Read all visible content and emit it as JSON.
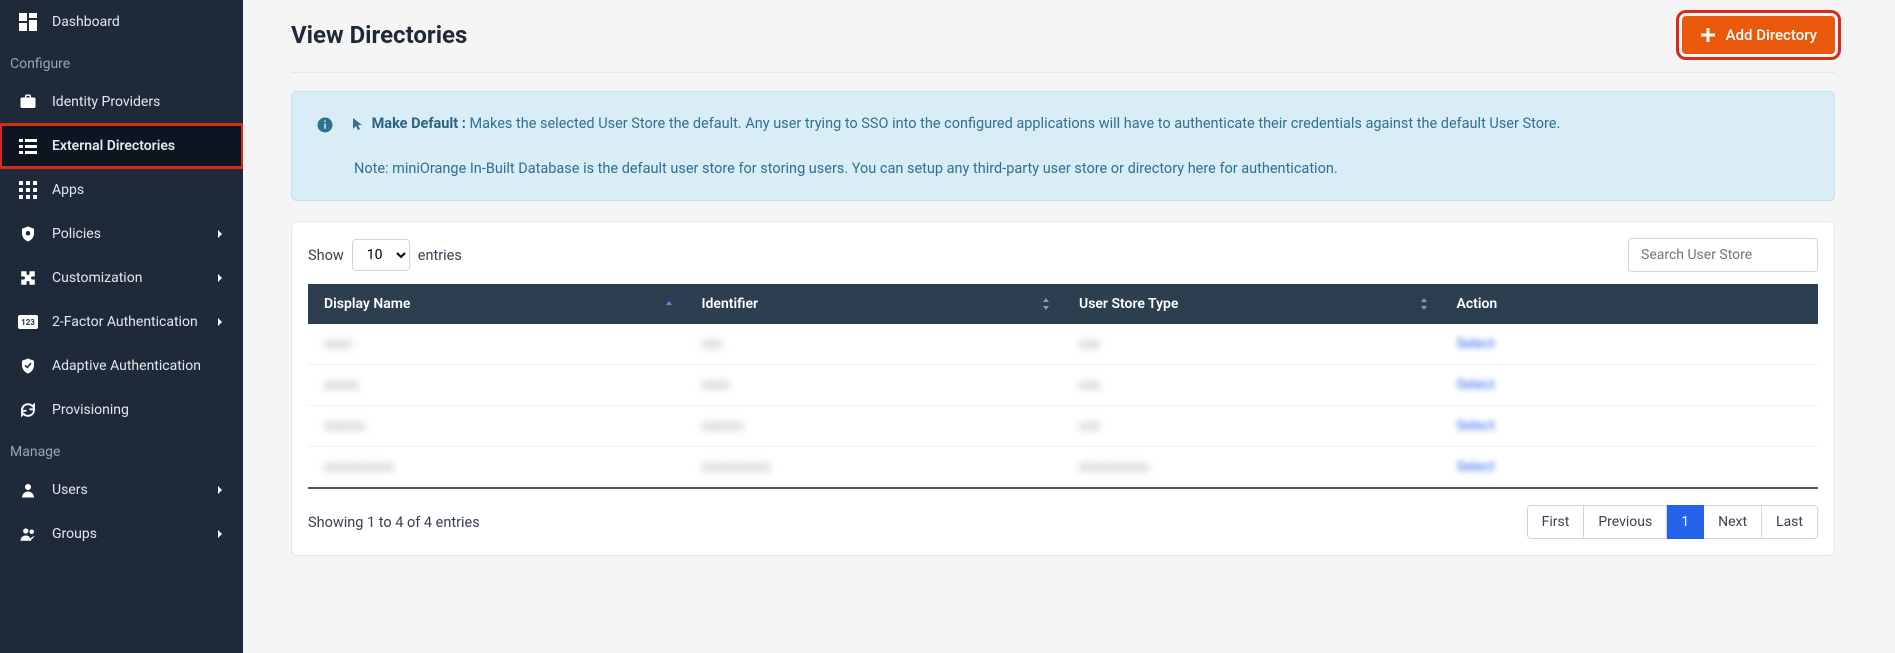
{
  "sidebar": {
    "top_item": {
      "label": "Dashboard"
    },
    "section_configure": "Configure",
    "items": [
      {
        "label": "Identity Providers",
        "icon": "briefcase",
        "chevron": false
      },
      {
        "label": "External Directories",
        "icon": "list",
        "chevron": false,
        "active": true
      },
      {
        "label": "Apps",
        "icon": "grid",
        "chevron": false
      },
      {
        "label": "Policies",
        "icon": "shield-gear",
        "chevron": true
      },
      {
        "label": "Customization",
        "icon": "puzzle",
        "chevron": true
      },
      {
        "label": "2-Factor Authentication",
        "icon": "badge-123",
        "chevron": true
      },
      {
        "label": "Adaptive Authentication",
        "icon": "shield-check",
        "chevron": false
      },
      {
        "label": "Provisioning",
        "icon": "sync",
        "chevron": false
      }
    ],
    "section_manage": "Manage",
    "manage_items": [
      {
        "label": "Users",
        "icon": "user",
        "chevron": true
      },
      {
        "label": "Groups",
        "icon": "users",
        "chevron": true
      }
    ]
  },
  "page": {
    "title": "View Directories",
    "add_button": "Add Directory"
  },
  "info": {
    "make_default_label": "Make Default :",
    "make_default_text": "Makes the selected User Store the default. Any user trying to SSO into the configured applications will have to authenticate their credentials against the default User Store.",
    "note": "Note: miniOrange In-Built Database is the default user store for storing users. You can setup any third-party user store or directory here for authentication."
  },
  "table": {
    "show_label": "Show",
    "entries_label": "entries",
    "page_size": "10",
    "search_placeholder": "Search User Store",
    "columns": {
      "display_name": "Display Name",
      "identifier": "Identifier",
      "user_store_type": "User Store Type",
      "action": "Action"
    },
    "rows": [
      {
        "display": "xxxx",
        "identifier": "xxx",
        "type": "xxx",
        "action": "Select"
      },
      {
        "display": "xxxxx",
        "identifier": "xxxx",
        "type": "xxx",
        "action": "Select"
      },
      {
        "display": "xxxxxx",
        "identifier": "xxxxxx",
        "type": "xxx",
        "action": "Select"
      },
      {
        "display": "xxxxxxxxxx",
        "identifier": "xxxxxxxxxx",
        "type": "xxxxxxxxxx",
        "action": "Select"
      }
    ],
    "showing_text": "Showing 1 to 4 of 4 entries",
    "pagination": {
      "first": "First",
      "prev": "Previous",
      "pages": [
        "1"
      ],
      "next": "Next",
      "last": "Last"
    }
  }
}
